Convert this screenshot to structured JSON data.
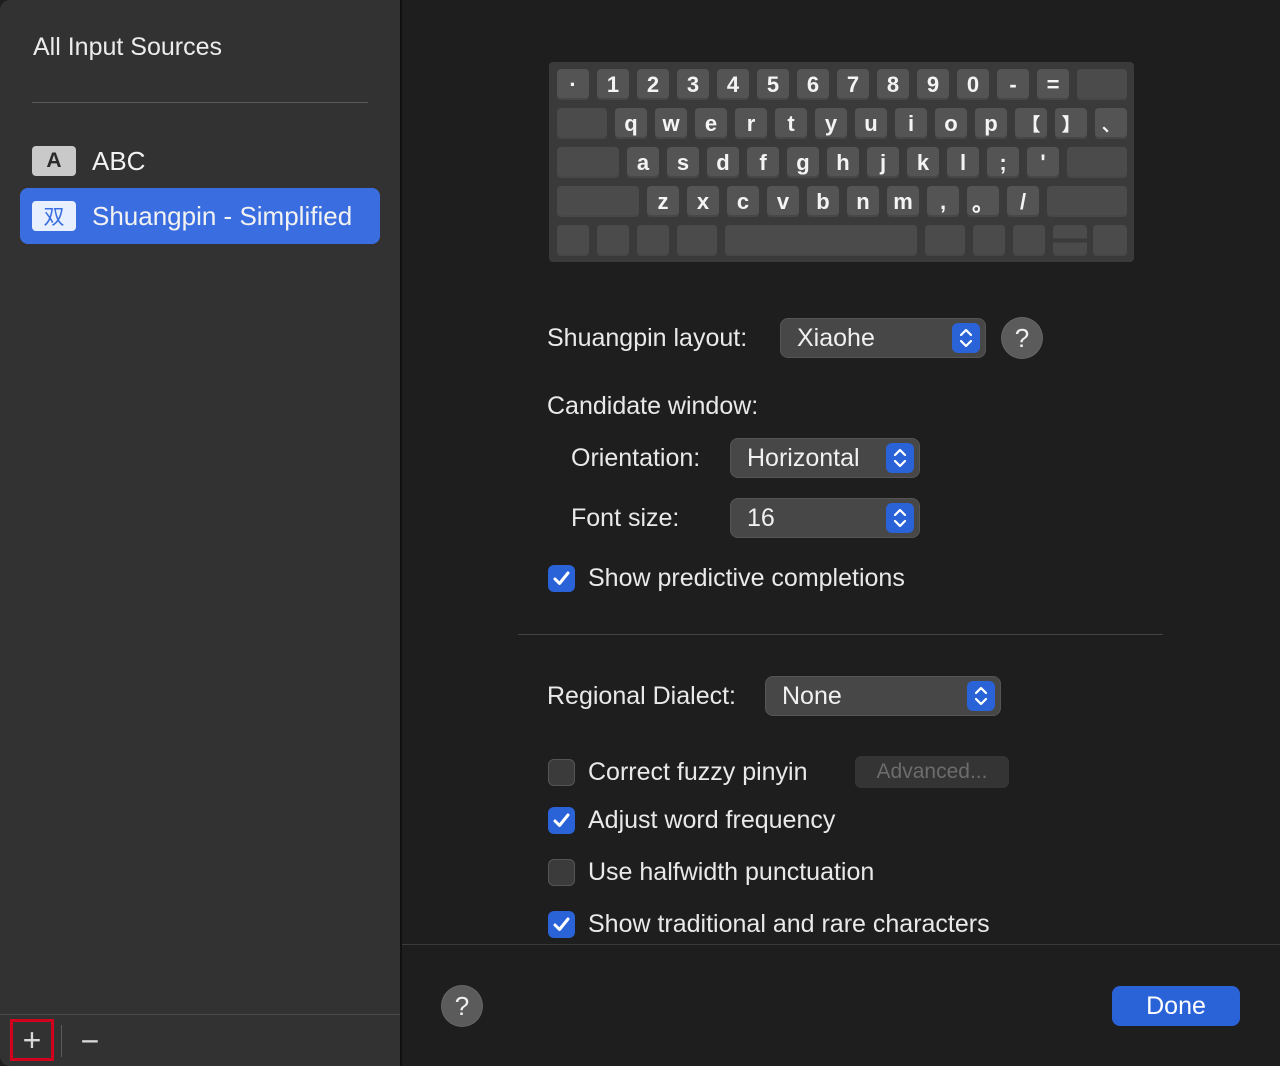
{
  "sidebar": {
    "title": "All Input Sources",
    "sources": [
      {
        "badge": "A",
        "label": "ABC",
        "selected": false
      },
      {
        "badge": "双",
        "label": "Shuangpin - Simplified",
        "selected": true
      }
    ],
    "add_label": "+",
    "remove_label": "−"
  },
  "keyboard": {
    "rows": [
      [
        "·",
        "1",
        "2",
        "3",
        "4",
        "5",
        "6",
        "7",
        "8",
        "9",
        "0",
        "-",
        "="
      ],
      [
        "q",
        "w",
        "e",
        "r",
        "t",
        "y",
        "u",
        "i",
        "o",
        "p",
        "【",
        "】",
        "、"
      ],
      [
        "a",
        "s",
        "d",
        "f",
        "g",
        "h",
        "j",
        "k",
        "l",
        ";",
        "'"
      ],
      [
        "z",
        "x",
        "c",
        "v",
        "b",
        "n",
        "m",
        ",",
        "。",
        "/"
      ]
    ]
  },
  "settings": {
    "layout_label": "Shuangpin layout:",
    "layout_value": "Xiaohe",
    "candidate_label": "Candidate window:",
    "orientation_label": "Orientation:",
    "orientation_value": "Horizontal",
    "font_size_label": "Font size:",
    "font_size_value": "16",
    "predictive_label": "Show predictive completions",
    "predictive_checked": true,
    "dialect_label": "Regional Dialect:",
    "dialect_value": "None",
    "fuzzy_label": "Correct fuzzy pinyin",
    "fuzzy_checked": false,
    "advanced_label": "Advanced...",
    "adjust_label": "Adjust word frequency",
    "adjust_checked": true,
    "halfwidth_label": "Use halfwidth punctuation",
    "halfwidth_checked": false,
    "traditional_label": "Show traditional and rare characters",
    "traditional_checked": true
  },
  "footer": {
    "help_label": "?",
    "done_label": "Done"
  },
  "colors": {
    "accent": "#2a63d8",
    "selection": "#3a6ee0",
    "highlight_border": "#d0021b"
  }
}
